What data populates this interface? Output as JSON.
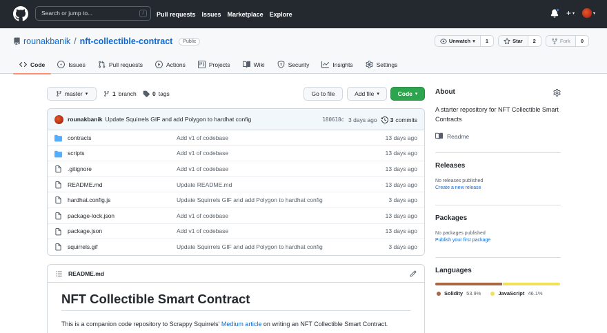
{
  "header": {
    "search_placeholder": "Search or jump to...",
    "search_shortcut": "/",
    "nav": [
      "Pull requests",
      "Issues",
      "Marketplace",
      "Explore"
    ]
  },
  "repo": {
    "owner": "rounakbanik",
    "separator": "/",
    "name": "nft-collectible-contract",
    "visibility": "Public",
    "watch_label": "Unwatch",
    "watch_count": "1",
    "star_label": "Star",
    "star_count": "2",
    "fork_label": "Fork",
    "fork_count": "0"
  },
  "tabs": [
    {
      "label": "Code",
      "icon": "code-icon"
    },
    {
      "label": "Issues",
      "icon": "issue-icon"
    },
    {
      "label": "Pull requests",
      "icon": "pull-request-icon"
    },
    {
      "label": "Actions",
      "icon": "play-icon"
    },
    {
      "label": "Projects",
      "icon": "project-icon"
    },
    {
      "label": "Wiki",
      "icon": "book-icon"
    },
    {
      "label": "Security",
      "icon": "shield-icon"
    },
    {
      "label": "Insights",
      "icon": "graph-icon"
    },
    {
      "label": "Settings",
      "icon": "gear-icon"
    }
  ],
  "branch": {
    "current": "master",
    "branch_count": "1",
    "branch_word": "branch",
    "tag_count": "0",
    "tag_word": "tags",
    "go_to_file": "Go to file",
    "add_file": "Add file",
    "code_button": "Code"
  },
  "commit": {
    "author": "rounakbanik",
    "message": "Update Squirrels GIF and add Polygon to hardhat config",
    "sha": "180618c",
    "age": "3 days ago",
    "count": "3",
    "count_word": "commits"
  },
  "files": [
    {
      "type": "dir",
      "name": "contracts",
      "message": "Add v1 of codebase",
      "age": "13 days ago"
    },
    {
      "type": "dir",
      "name": "scripts",
      "message": "Add v1 of codebase",
      "age": "13 days ago"
    },
    {
      "type": "file",
      "name": ".gitignore",
      "message": "Add v1 of codebase",
      "age": "13 days ago"
    },
    {
      "type": "file",
      "name": "README.md",
      "message": "Update README.md",
      "age": "13 days ago"
    },
    {
      "type": "file",
      "name": "hardhat.config.js",
      "message": "Update Squirrels GIF and add Polygon to hardhat config",
      "age": "3 days ago"
    },
    {
      "type": "file",
      "name": "package-lock.json",
      "message": "Add v1 of codebase",
      "age": "13 days ago"
    },
    {
      "type": "file",
      "name": "package.json",
      "message": "Add v1 of codebase",
      "age": "13 days ago"
    },
    {
      "type": "file",
      "name": "squirrels.gif",
      "message": "Update Squirrels GIF and add Polygon to hardhat config",
      "age": "3 days ago"
    }
  ],
  "readme": {
    "filename": "README.md",
    "heading": "NFT Collectible Smart Contract",
    "text_before": "This is a companion code repository to Scrappy Squirrels' ",
    "link_text": "Medium article",
    "text_after": " on writing an NFT Collectible Smart Contract."
  },
  "sidebar": {
    "about_title": "About",
    "about_description": "A starter repository for NFT Collectible Smart Contracts",
    "readme_label": "Readme",
    "releases_title": "Releases",
    "releases_empty": "No releases published",
    "releases_link": "Create a new release",
    "packages_title": "Packages",
    "packages_empty": "No packages published",
    "packages_link": "Publish your first package",
    "languages_title": "Languages",
    "languages": [
      {
        "name": "Solidity",
        "percent": "53.9%",
        "share": 53.9,
        "color": "#AA6746"
      },
      {
        "name": "JavaScript",
        "percent": "46.1%",
        "share": 46.1,
        "color": "#F1E05A"
      }
    ]
  },
  "colors": {
    "topbar": "#24292f",
    "link": "#0969da",
    "green_button": "#2da44e",
    "tab_underline": "#fd8c73",
    "folder": "#54aeff"
  }
}
